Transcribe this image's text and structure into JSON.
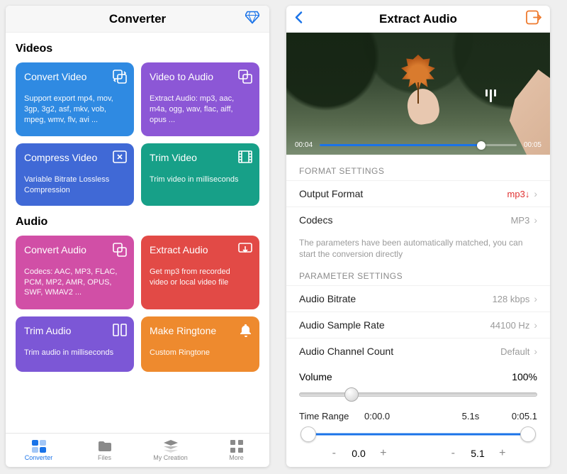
{
  "left": {
    "title": "Converter",
    "sections": {
      "videos": {
        "label": "Videos"
      },
      "audio": {
        "label": "Audio"
      }
    },
    "cards": {
      "convert_video": {
        "title": "Convert Video",
        "desc": "Support export mp4, mov, 3gp, 3g2, asf, mkv, vob, mpeg, wmv, flv, avi ...",
        "color": "#2f8ae2"
      },
      "video_to_audio": {
        "title": "Video to Audio",
        "desc": "Extract Audio: mp3, aac, m4a, ogg, wav, flac, aiff, opus ...",
        "color": "#8c57d6"
      },
      "compress_video": {
        "title": "Compress Video",
        "desc": "Variable Bitrate Lossless Compression",
        "color": "#4069d6"
      },
      "trim_video": {
        "title": "Trim Video",
        "desc": "Trim video in milliseconds",
        "color": "#17a088"
      },
      "convert_audio": {
        "title": "Convert Audio",
        "desc": "Codecs: AAC, MP3, FLAC, PCM, MP2, AMR, OPUS, SWF, WMAV2 ...",
        "color": "#d14fa6"
      },
      "extract_audio": {
        "title": "Extract Audio",
        "desc": "Get mp3 from recorded video or local video file",
        "color": "#e24a46"
      },
      "trim_audio": {
        "title": "Trim Audio",
        "desc": "Trim audio in milliseconds",
        "color": "#7c57d6"
      },
      "make_ringtone": {
        "title": "Make Ringtone",
        "desc": "Custom Ringtone",
        "color": "#ee8a2e"
      }
    },
    "tabs": {
      "converter": "Converter",
      "files": "Files",
      "my_creation": "My Creation",
      "more": "More"
    }
  },
  "right": {
    "title": "Extract Audio",
    "video": {
      "current": "00:04",
      "total": "00:05",
      "progress_pct": 82
    },
    "format_header": "FORMAT SETTINGS",
    "param_header": "PARAMETER SETTINGS",
    "rows": {
      "output_format": {
        "label": "Output Format",
        "value": "mp3"
      },
      "codecs": {
        "label": "Codecs",
        "value": "MP3"
      },
      "hint": "The parameters have been automatically matched, you can start the conversion directly",
      "audio_bitrate": {
        "label": "Audio Bitrate",
        "value": "128 kbps"
      },
      "audio_sample_rate": {
        "label": "Audio Sample Rate",
        "value": "44100 Hz"
      },
      "audio_channel_count": {
        "label": "Audio Channel Count",
        "value": "Default"
      },
      "volume": {
        "label": "Volume",
        "value": "100%",
        "knob_pct": 22
      },
      "time_range": {
        "label": "Time Range",
        "start": "0:00.0",
        "mid": "5.1s",
        "end": "0:05.1",
        "stepper_start": "0.0",
        "stepper_end": "5.1"
      }
    }
  }
}
